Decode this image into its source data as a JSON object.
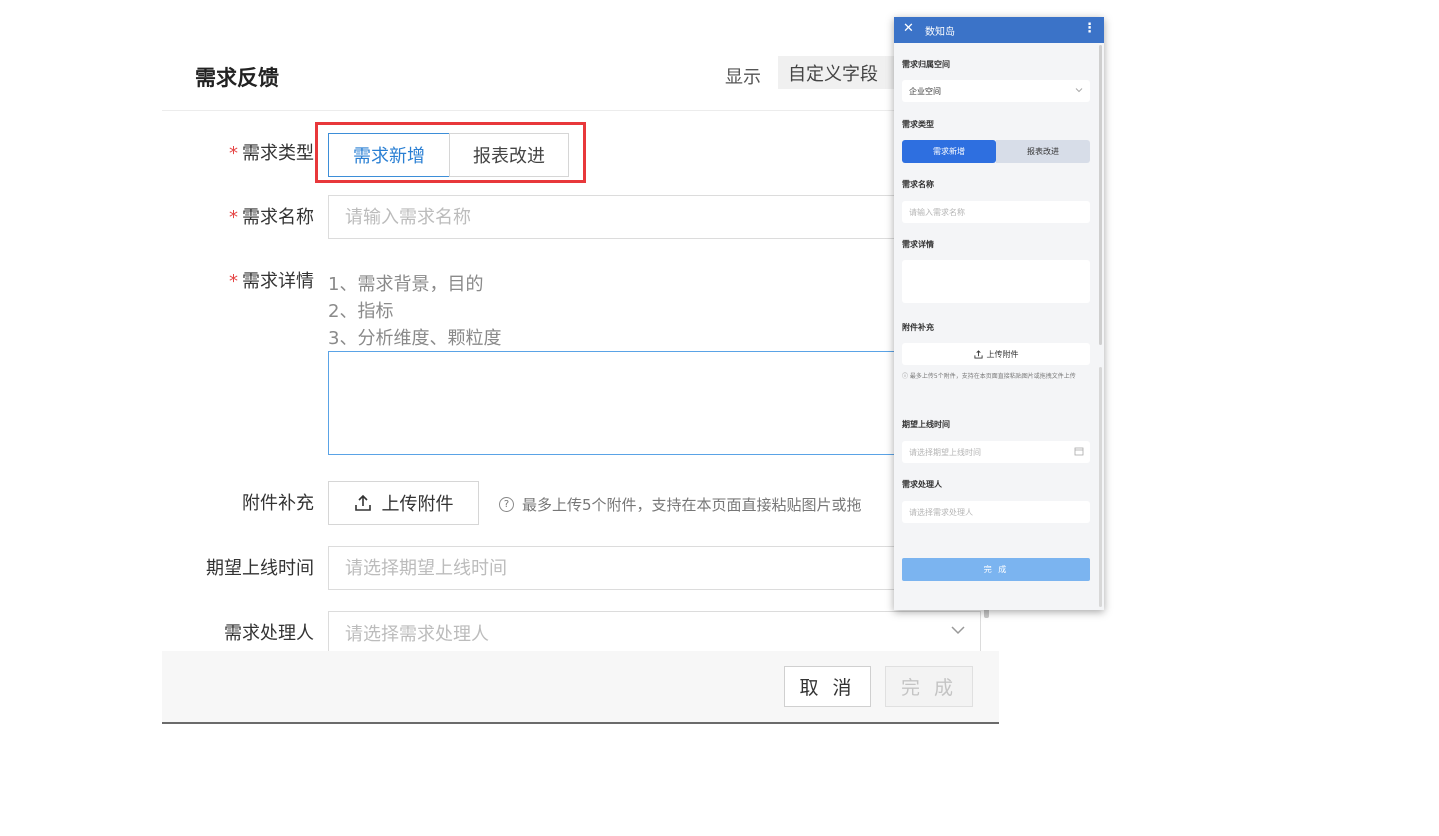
{
  "form": {
    "title": "需求反馈",
    "show_label": "显示",
    "custom_fields_label": "自定义字段",
    "required_mark": "*",
    "type_label": "需求类型",
    "type_options": [
      "需求新增",
      "报表改进"
    ],
    "name_label": "需求名称",
    "name_placeholder": "请输入需求名称",
    "detail_label": "需求详情",
    "detail_hints": [
      "1、需求背景，目的",
      "2、指标",
      "3、分析维度、颗粒度"
    ],
    "attach_label": "附件补充",
    "upload_label": "上传附件",
    "upload_note": "最多上传5个附件，支持在本页面直接粘贴图片或拖",
    "date_label": "期望上线时间",
    "date_placeholder": "请选择期望上线时间",
    "handler_label": "需求处理人",
    "handler_placeholder": "请选择需求处理人",
    "cancel_label": "取 消",
    "done_label": "完 成"
  },
  "mobile": {
    "app_title": "数知岛",
    "space_label": "需求归属空间",
    "space_value": "企业空间",
    "type_label": "需求类型",
    "type_options": [
      "需求新增",
      "报表改进"
    ],
    "name_label": "需求名称",
    "name_placeholder": "请输入需求名称",
    "detail_label": "需求详情",
    "attach_label": "附件补充",
    "upload_label": "上传附件",
    "upload_note": "最多上传5个附件，支持在本页面直接粘贴图片或拖拽文件上传",
    "date_label": "期望上线时间",
    "date_placeholder": "请选择期望上线时间",
    "handler_label": "需求处理人",
    "handler_placeholder": "请选择需求处理人",
    "done_label": "完 成"
  },
  "colors": {
    "accent": "#2a7fd3",
    "highlight_border": "#e8383b",
    "mobile_header": "#3b73c8",
    "required": "#e54545"
  }
}
